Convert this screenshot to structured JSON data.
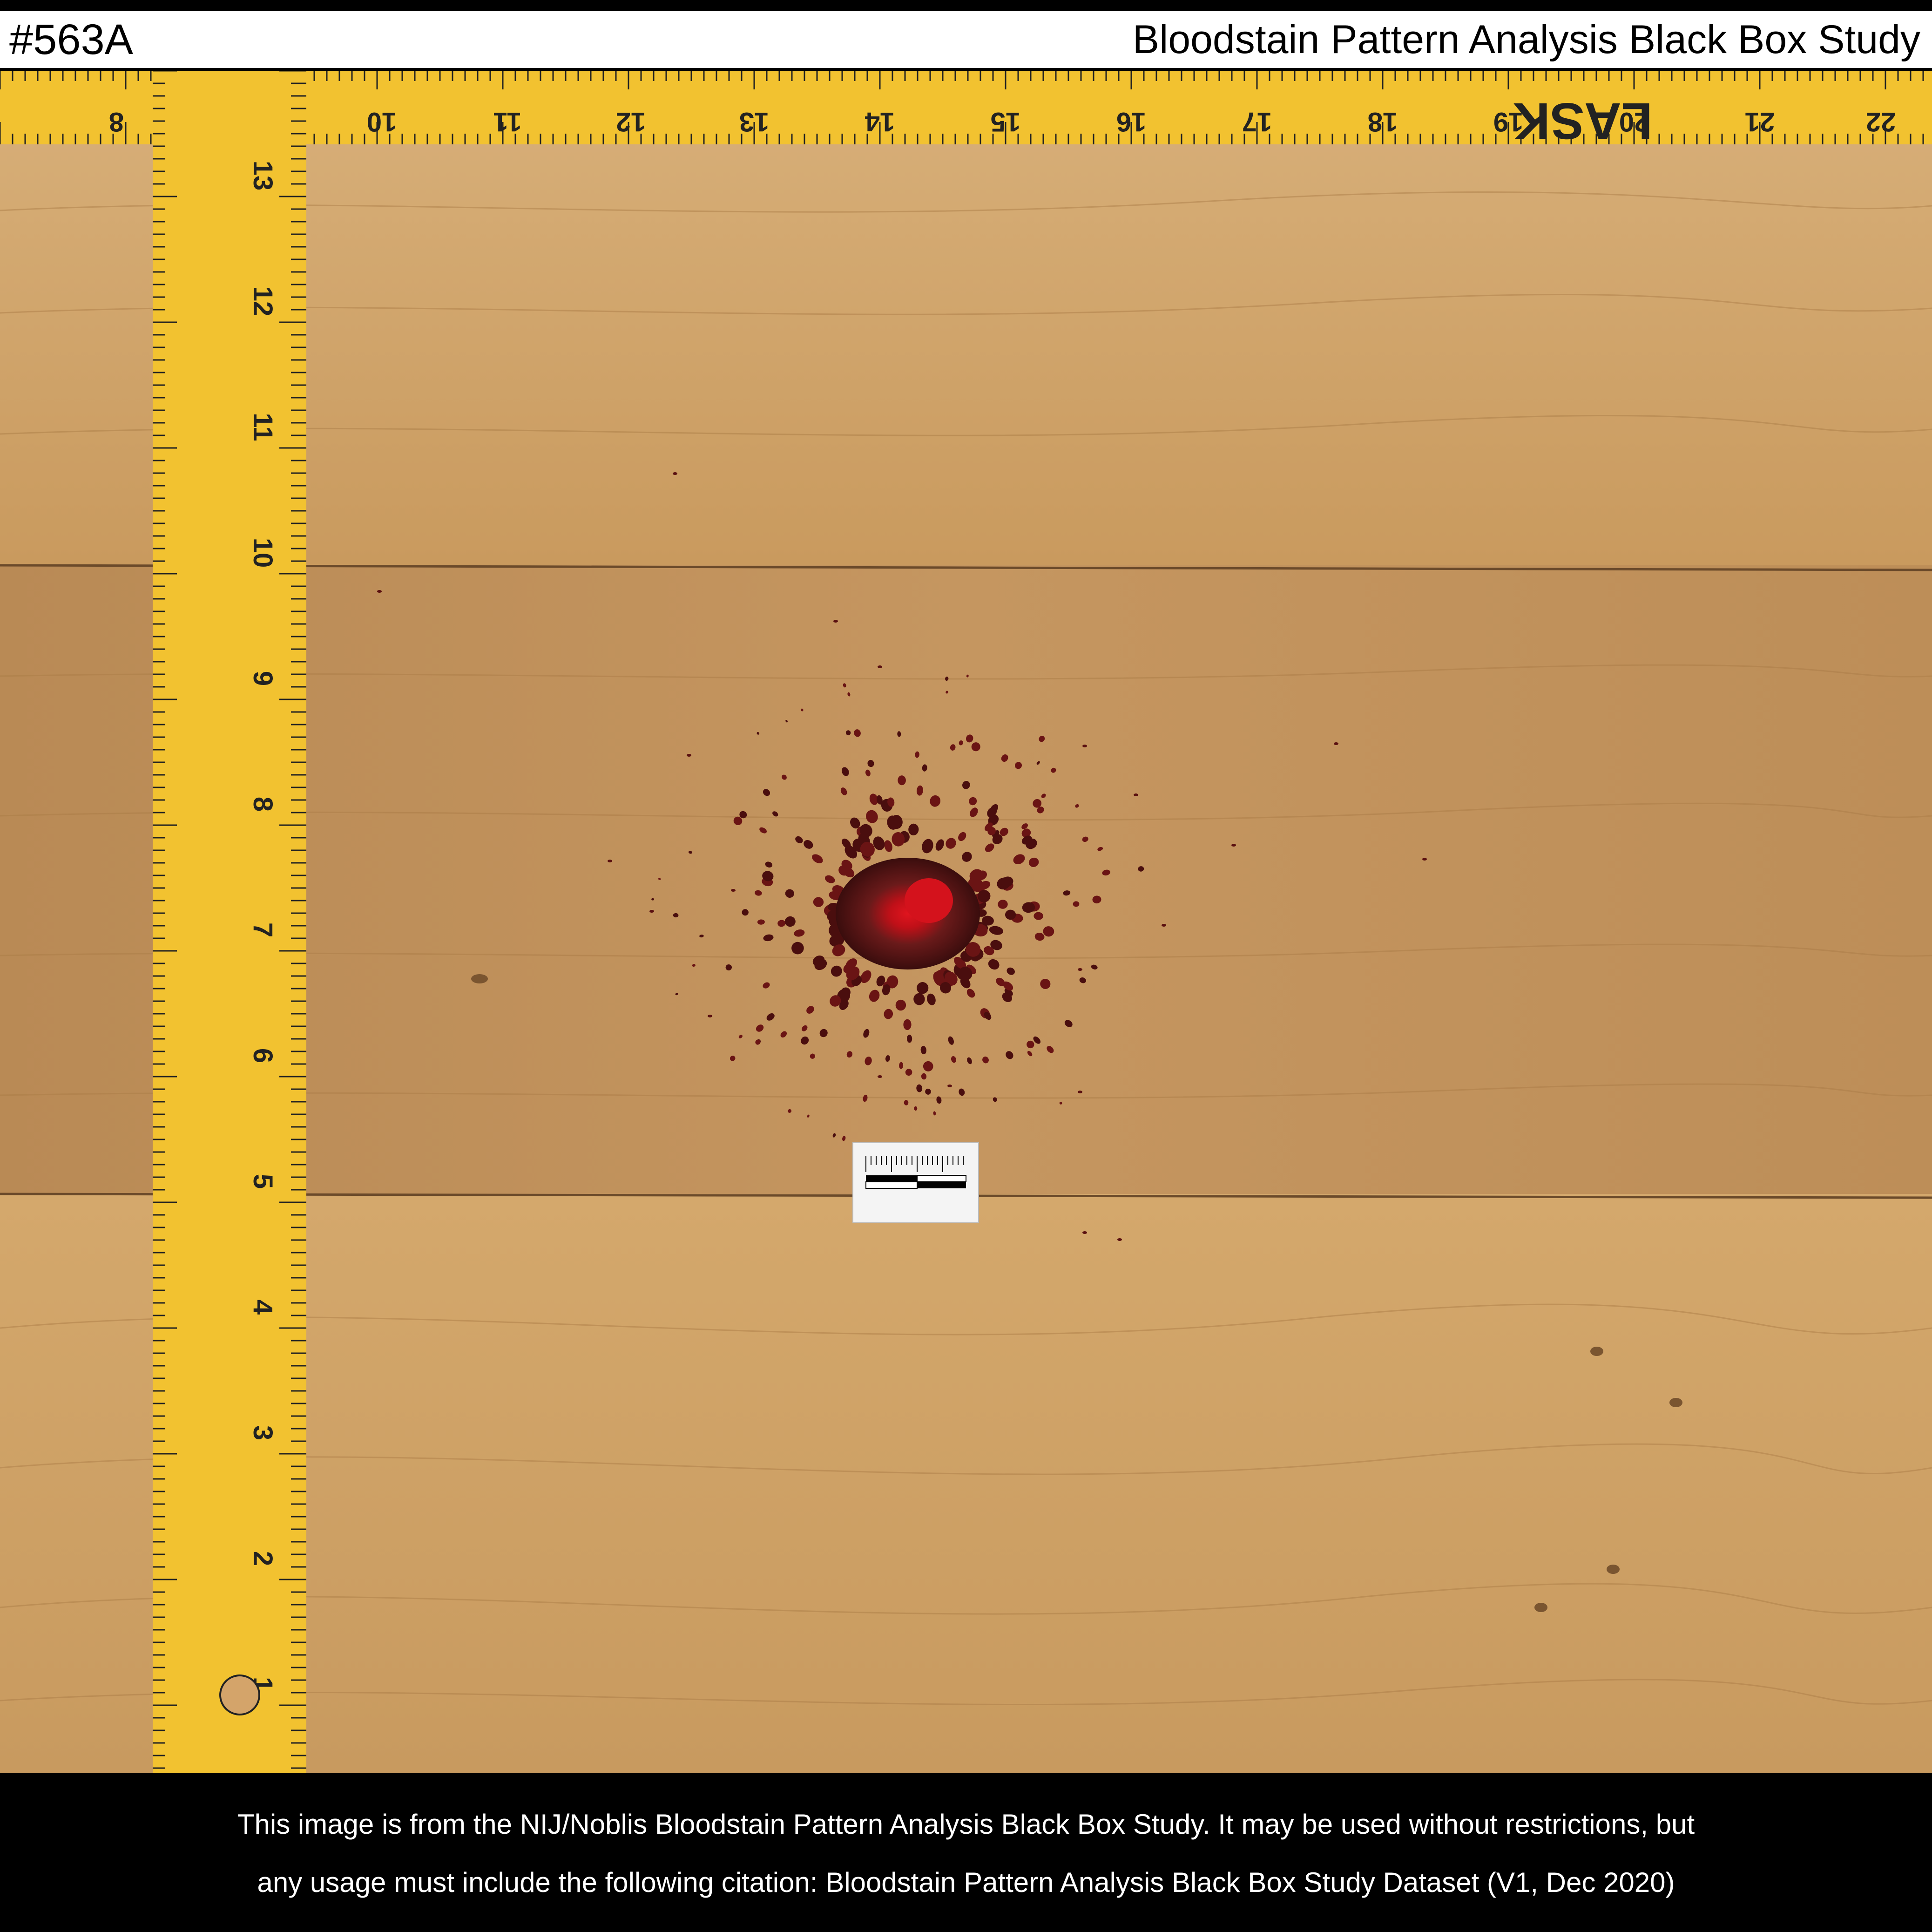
{
  "header": {
    "id_label": "#563A",
    "title": "Bloodstain Pattern Analysis Black Box Study"
  },
  "footer": {
    "line1": "This image is from the NIJ/Noblis Bloodstain Pattern Analysis Black Box Study. It may be used without restrictions, but",
    "line2": "any usage must include the following citation:  Bloodstain Pattern Analysis Black Box Study Dataset (V1, Dec 2020)"
  },
  "photo": {
    "ruler_top_brand": "LASK",
    "ruler_top_numbers": [
      "8",
      "10",
      "11",
      "12",
      "13",
      "14",
      "15",
      "16",
      "17",
      "18",
      "19",
      "20",
      "21",
      "22"
    ],
    "ruler_left_numbers": [
      "13",
      "12",
      "11",
      "10",
      "9",
      "8",
      "7",
      "6",
      "5",
      "4",
      "3",
      "2",
      "1"
    ],
    "colors": {
      "wood": "#c9985a",
      "ruler": "#f2c230",
      "blood": "#6a0a0a",
      "blood_center": "#c8101a"
    }
  }
}
